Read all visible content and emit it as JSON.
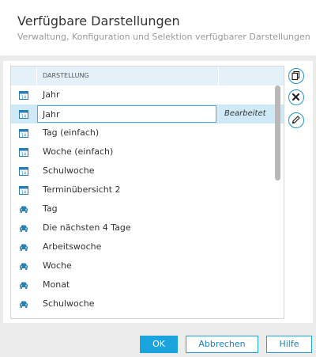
{
  "dialog": {
    "title": "Verfügbare Darstellungen",
    "subtitle": "Verwaltung, Konfiguration und Selektion verfügbarer Darstellungen"
  },
  "table": {
    "column_header": "DARSTELLUNG",
    "rows": [
      {
        "label": "Jahr",
        "icon": "calendar-icon",
        "status": ""
      },
      {
        "label": "Jahr",
        "icon": "calendar-icon",
        "status": "Bearbeitet"
      },
      {
        "label": "Tag (einfach)",
        "icon": "calendar-icon",
        "status": ""
      },
      {
        "label": "Woche (einfach)",
        "icon": "calendar-icon",
        "status": ""
      },
      {
        "label": "Schulwoche",
        "icon": "calendar-icon",
        "status": ""
      },
      {
        "label": "Terminübersicht 2",
        "icon": "calendar-icon",
        "status": ""
      },
      {
        "label": "Tag",
        "icon": "car-icon",
        "status": ""
      },
      {
        "label": "Die nächsten 4 Tage",
        "icon": "car-icon",
        "status": ""
      },
      {
        "label": "Arbeitswoche",
        "icon": "car-icon",
        "status": ""
      },
      {
        "label": "Woche",
        "icon": "car-icon",
        "status": ""
      },
      {
        "label": "Monat",
        "icon": "car-icon",
        "status": ""
      },
      {
        "label": "Schulwoche",
        "icon": "car-icon",
        "status": ""
      }
    ]
  },
  "side_actions": [
    "copy-icon",
    "delete-icon",
    "edit-pencil-icon"
  ],
  "buttons": {
    "ok": "OK",
    "cancel": "Abbrechen",
    "help": "Hilfe"
  },
  "colors": {
    "accent": "#1aa3dd",
    "selected_row": "#cfe9f7",
    "header_row": "#e5f1f8"
  }
}
